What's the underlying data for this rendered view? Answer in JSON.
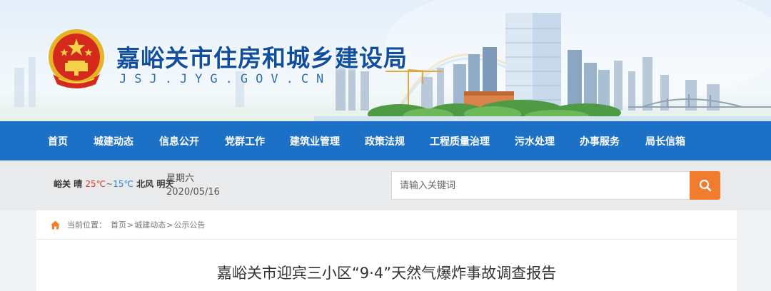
{
  "header": {
    "title": "嘉峪关市住房和城乡建设局",
    "domain": "JSJ.JYG.GOV.CN"
  },
  "nav": {
    "items": [
      "首页",
      "城建动态",
      "信息公开",
      "党群工作",
      "建筑业管理",
      "政策法规",
      "工程质量治理",
      "污水处理",
      "办事服务",
      "局长信箱"
    ]
  },
  "infobar": {
    "weather": {
      "city": "峪关",
      "condition": "晴",
      "high": "25℃",
      "tilde": "~",
      "low": "15℃",
      "wind": "北风",
      "tail": "明天"
    },
    "weekday": "星期六",
    "date": "2020/05/16",
    "search": {
      "placeholder": "请输入关键词"
    }
  },
  "breadcrumb": {
    "prefix": "当前位置：",
    "items": [
      "首页",
      "城建动态",
      "公示公告"
    ],
    "separator": ">"
  },
  "article": {
    "title": "嘉峪关市迎宾三小区“9·4”天然气爆炸事故调查报告"
  },
  "colors": {
    "nav_bg": "#1c70c6",
    "title_blue": "#0f4f9e",
    "search_button": "#f07d2e",
    "temp_high": "#e13a2c",
    "temp_low": "#2a82d8"
  },
  "icons": [
    "national-emblem",
    "search-icon",
    "home-icon"
  ]
}
